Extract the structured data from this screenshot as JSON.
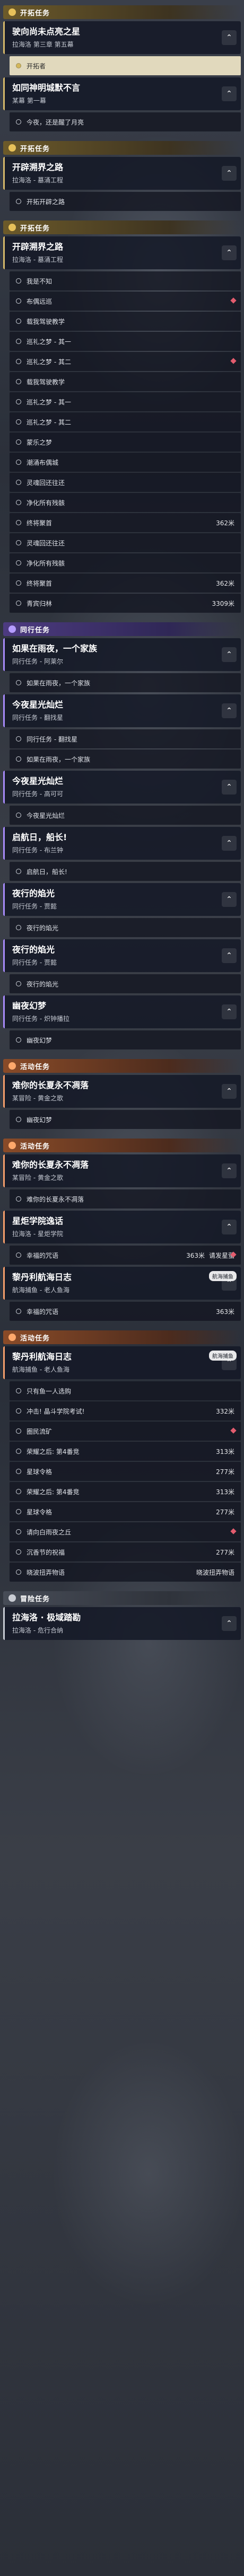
{
  "sections": [
    {
      "header": "开拓任务",
      "theme": "gold",
      "blocks": [
        {
          "type": "card",
          "title": "驶向尚未点亮之星",
          "sub": "拉海洛 第三章 第五幕",
          "theme": "gold",
          "chevron": "⌃"
        },
        {
          "type": "obj",
          "text": "开拓者",
          "highlight": true
        },
        {
          "type": "card",
          "title": "如同神明城默不言",
          "sub": "某幕 第一幕",
          "theme": "gold",
          "chevron": "⌃"
        },
        {
          "type": "obj",
          "text": "今夜，还是醒了月亮"
        }
      ]
    },
    {
      "header": "开拓任务",
      "theme": "gold",
      "blocks": [
        {
          "type": "card",
          "title": "开辟溯界之路",
          "sub": "拉海洛 - 墓涌工程",
          "theme": "gold",
          "chevron": "⌃"
        },
        {
          "type": "obj",
          "text": "开拓开辟之路"
        }
      ]
    },
    {
      "header": "开拓任务",
      "theme": "gold",
      "blocks": [
        {
          "type": "card",
          "title": "开辟溯界之路",
          "sub": "拉海洛 - 墓涌工程",
          "theme": "gold",
          "chevron": "⌃"
        },
        {
          "type": "obj",
          "text": "我是不知"
        },
        {
          "type": "obj",
          "text": "布偶远巡",
          "diamond": true
        },
        {
          "type": "obj",
          "text": "载我驾驶教学"
        },
        {
          "type": "obj",
          "text": "巡礼之梦 - 其一"
        },
        {
          "type": "obj",
          "text": "巡礼之梦 - 其二",
          "diamond": true
        },
        {
          "type": "obj",
          "text": "载我驾驶教学"
        },
        {
          "type": "obj",
          "text": "巡礼之梦 - 其一"
        },
        {
          "type": "obj",
          "text": "巡礼之梦 - 其二"
        },
        {
          "type": "obj",
          "text": "蒙乐之梦"
        },
        {
          "type": "obj",
          "text": "潮涌布偶城"
        },
        {
          "type": "obj",
          "text": "灵魂回还往还"
        },
        {
          "type": "obj",
          "text": "净化所有残骸"
        },
        {
          "type": "obj",
          "text": "终将聚首",
          "dist": "362米"
        },
        {
          "type": "obj",
          "text": "灵魂回还往还"
        },
        {
          "type": "obj",
          "text": "净化所有残骸"
        },
        {
          "type": "obj",
          "text": "终将聚首",
          "dist": "362米"
        },
        {
          "type": "obj",
          "text": "青宾归林",
          "dist": "3309米"
        }
      ]
    },
    {
      "header": "同行任务",
      "theme": "purple",
      "blocks": [
        {
          "type": "card",
          "title": "如果在雨夜，一个家族",
          "sub": "同行任务 - 阿莱尔",
          "theme": "purple",
          "chevron": "⌃"
        },
        {
          "type": "obj",
          "text": "如果在雨夜，一个家族"
        },
        {
          "type": "card",
          "title": "今夜星光灿烂",
          "sub": "同行任务 - 翻找星",
          "theme": "purple",
          "chevron": "⌃"
        },
        {
          "type": "obj",
          "text": "同行任务 - 翻找星"
        },
        {
          "type": "obj",
          "text": "如果在雨夜，一个家族"
        },
        {
          "type": "card",
          "title": "今夜星光灿烂",
          "sub": "同行任务 - 高可可",
          "theme": "purple",
          "chevron": "⌃"
        },
        {
          "type": "obj",
          "text": "今夜星光灿烂"
        },
        {
          "type": "card",
          "title": "启航日，船长!",
          "sub": "同行任务 - 布兰钟",
          "theme": "purple",
          "chevron": "⌃"
        },
        {
          "type": "obj",
          "text": "启航日，船长!"
        },
        {
          "type": "card",
          "title": "夜行的焰光",
          "sub": "同行任务 - 贾懿",
          "theme": "purple",
          "chevron": "⌃"
        },
        {
          "type": "obj",
          "text": "夜行的焰光"
        },
        {
          "type": "card",
          "title": "夜行的焰光",
          "sub": "同行任务 - 贾懿",
          "theme": "purple",
          "chevron": "⌃"
        },
        {
          "type": "obj",
          "text": "夜行的焰光"
        },
        {
          "type": "card",
          "title": "幽夜幻梦",
          "sub": "同行任务 - 炽钟播拉",
          "theme": "purple",
          "chevron": "⌃"
        },
        {
          "type": "obj",
          "text": "幽夜幻梦"
        }
      ]
    },
    {
      "header": "活动任务",
      "theme": "orange",
      "blocks": [
        {
          "type": "card",
          "title": "难你的长夏永不凋落",
          "sub": "某冒险 - 黄金之歌",
          "theme": "orange",
          "chevron": "⌃"
        },
        {
          "type": "obj",
          "text": "幽夜幻梦"
        }
      ]
    },
    {
      "header": "活动任务",
      "theme": "orange",
      "blocks": [
        {
          "type": "card",
          "title": "难你的长夏永不凋落",
          "sub": "某冒险 - 黄金之歌",
          "theme": "orange",
          "chevron": "⌃"
        },
        {
          "type": "obj",
          "text": "难你的长夏永不凋落"
        },
        {
          "type": "card",
          "title": "星炬学院逸话",
          "sub": "拉海洛 - 星炬学院",
          "theme": "orange",
          "chevron": "⌃"
        },
        {
          "type": "obj",
          "text": "幸福的咒语",
          "dist": "363米",
          "tag": "请发星萤",
          "diamond": true
        },
        {
          "type": "card",
          "title": "黎丹利航海日志",
          "sub": "航海捕鱼 - 老人鱼海",
          "theme": "orange",
          "chevron": "⌃",
          "tag": "航海捕鱼"
        },
        {
          "type": "obj",
          "text": "幸福的咒语",
          "dist": "363米"
        }
      ]
    },
    {
      "header": "活动任务",
      "theme": "orange",
      "blocks": [
        {
          "type": "card",
          "title": "黎丹利航海日志",
          "sub": "航海捕鱼 - 老人鱼海",
          "theme": "orange",
          "chevron": "⌃",
          "tag": "航海捕鱼"
        },
        {
          "type": "obj",
          "text": "只有鱼一人选购"
        },
        {
          "type": "obj",
          "text": "冲击! 晶斗学院考试!",
          "dist": "332米"
        },
        {
          "type": "obj",
          "text": "圈民流矿",
          "diamond": true
        },
        {
          "type": "obj",
          "text": "荣耀之后: 第4番竞",
          "dist": "313米"
        },
        {
          "type": "obj",
          "text": "星球令格",
          "dist": "277米"
        },
        {
          "type": "obj",
          "text": "荣耀之后: 第4番竞",
          "dist": "313米"
        },
        {
          "type": "obj",
          "text": "星球令格",
          "dist": "277米"
        },
        {
          "type": "obj",
          "text": "请向白雨夜之丘",
          "diamond": true
        },
        {
          "type": "obj",
          "text": "沉香节的祝福",
          "dist": "277米"
        },
        {
          "type": "obj",
          "text": "晓波扭弄物语",
          "tag": "晓波扭弄物语"
        }
      ]
    },
    {
      "header": "冒险任务",
      "theme": "grey",
      "blocks": [
        {
          "type": "card",
          "title": "拉海洛 · 极域踏勘",
          "sub": "拉海洛 - 危行合纳",
          "theme": "grey",
          "chevron": "⌃"
        }
      ]
    }
  ]
}
